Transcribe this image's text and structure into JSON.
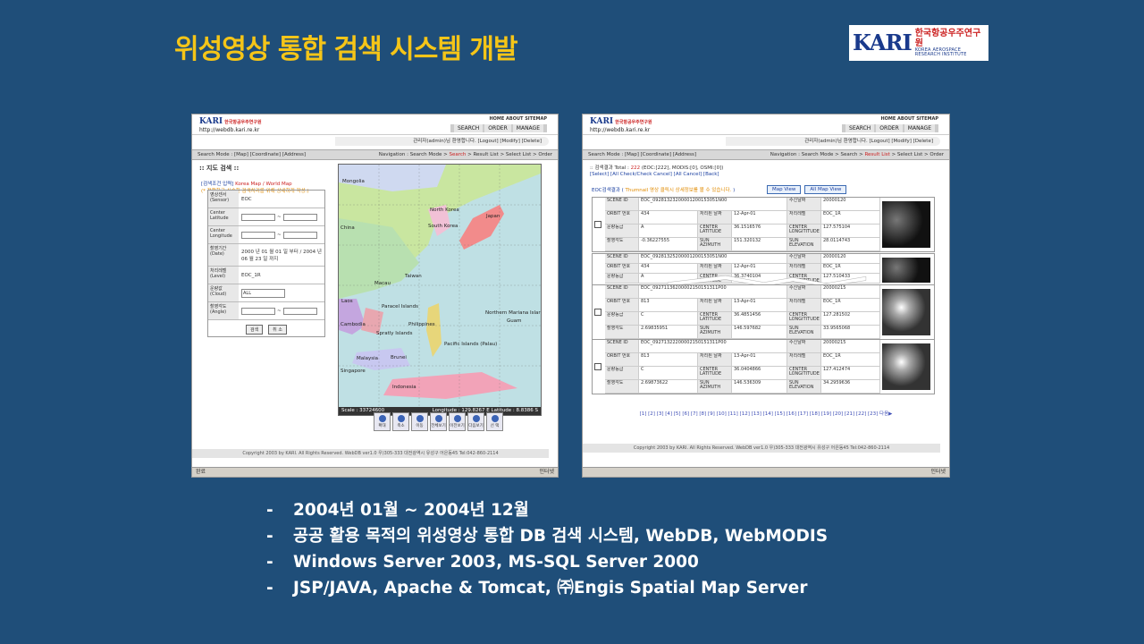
{
  "slide": {
    "title": "위성영상 통합 검색 시스템 개발",
    "logo": {
      "mark": "KARI",
      "korean": "한국항공우주연구원",
      "english": "KOREA AEROSPACE RESEARCH INSTITUTE"
    },
    "bullets": [
      "2004년 01월 ~ 2004년 12월",
      "공공 활용 목적의 위성영상 통합 DB 검색 시스템, WebDB, WebMODIS",
      "Windows Server 2003, MS-SQL Server 2000",
      "JSP/JAVA, Apache & Tomcat, ㈜Engis Spatial Map Server"
    ]
  },
  "site": {
    "logo": "KARI",
    "logo_sub": "한국항공우주연구원",
    "url": "http://webdb.kari.re.kr",
    "top_nav": "HOME  ABOUT  SITEMAP",
    "menu": [
      "SEARCH",
      "ORDER",
      "MANAGE"
    ],
    "login_bar": "관리자(admin)님 환영합니다.  [Logout]  [Modify]  [Delete]",
    "copyright": "Copyright 2003 by KARI. All Rights Reserved. WebDB ver1.0   우)305-333 대전광역시 유성구 어은동45 Tel:042-860-2114"
  },
  "left_shot": {
    "search_mode": "Search Mode : [Map]  [Coordinate]  [Address]",
    "navigation_prefix": "Navigation : Search Mode > ",
    "navigation_current": "Search",
    "navigation_suffix": " > Result List > Select List > Order",
    "form_title": ":: 지도 검색 ::",
    "form_hint_label": "[검색조건 입력]",
    "form_hint_korea": "Korea Map",
    "form_hint_sep": " / ",
    "form_hint_world": "World Map",
    "form_hint_note": "(* 정확하고 신속한 검색처리를 위해 상세하게 작성.)",
    "fields": [
      {
        "label": "영상센서 (Sensor)",
        "value": "EOC"
      },
      {
        "label": "Center Latitude",
        "value": "~"
      },
      {
        "label": "Center Longitude",
        "value": "~"
      },
      {
        "label": "촬영기간 (Date)",
        "value": "2000 년 01 월 01 일 부터 / 2004 년 06 월 23 일 까지"
      },
      {
        "label": "처리레벨 (Level)",
        "value": "EOC_1R"
      },
      {
        "label": "운량값 (Cloud)",
        "value": "ALL"
      },
      {
        "label": "촬영각도 (Angle)",
        "value": "~"
      }
    ],
    "search_btn": "검색",
    "cancel_btn": "취 소",
    "map_places": [
      "Mongolia",
      "North Korea",
      "South Korea",
      "China",
      "Japan",
      "Taiwan",
      "Macau",
      "Laos",
      "Paracel Islands",
      "Philippines",
      "Cambodia",
      "Spratly Islands",
      "Northern Mariana Islar",
      "Guam",
      "Pacific Islands (Palau)",
      "Malaysia",
      "Brunei",
      "Singapore",
      "Indonesia"
    ],
    "map_scale": "Scale : 33724600",
    "map_coords": "Longitude : 129.8267 E   Latitude : 8.8386 S",
    "tools": [
      "확대",
      "축소",
      "이동",
      "전체보기",
      "이전보기",
      "다음보기",
      "선 택"
    ],
    "status": "완료",
    "zone": "인터넷"
  },
  "right_shot": {
    "search_mode": "Search Mode : [Map]  [Coordinate]  [Address]",
    "navigation_prefix": "Navigation : Search Mode > Search > ",
    "navigation_current": "Result List",
    "navigation_suffix": " > Select List > Order",
    "total_prefix": ":: 검색결과 Total : ",
    "total_value": "222",
    "total_suffix": " (EOC:[222], MODIS:[0], OSMI:[0])",
    "links": "[Select] [All Check/Check Cancel] [All Cancel] [Back]",
    "caption_prefix": "EOC검색결과 ( ",
    "caption_note": "Thumnail 영상 클릭시 상세정보를 볼 수 있습니다.",
    "caption_suffix": " )",
    "btn_map_view": "Map View",
    "btn_all_map_view": "All Map View",
    "records": [
      {
        "scene": "EOC_09281323200001200153051N00",
        "orbit": "434",
        "proc_date": "12-Apr-01",
        "recv_date": "20000120",
        "level": "EOC_1R",
        "cloud": "A",
        "lat": "36.1516576",
        "lon": "127.575104",
        "angle": "-0.36227555",
        "sun_az": "151.320132",
        "sun_el": "28.0114743"
      },
      {
        "scene": "EOC_09281325200001200153051N00",
        "orbit": "434",
        "proc_date": "12-Apr-01",
        "recv_date": "20000120",
        "level": "EOC_1R",
        "cloud": "A",
        "lat": "36.3740104",
        "lon": "127.510433",
        "angle": "",
        "sun_az": "",
        "sun_el": ""
      },
      {
        "scene": "EOC_09271136200002150151311P00",
        "orbit": "813",
        "proc_date": "13-Apr-01",
        "recv_date": "20000215",
        "level": "EOC_1R",
        "cloud": "C",
        "lat": "36.4851456",
        "lon": "127.281502",
        "angle": "2.69835951",
        "sun_az": "146.597682",
        "sun_el": "33.9565068"
      },
      {
        "scene": "EOC_09271322200002150151311P00",
        "orbit": "813",
        "proc_date": "13-Apr-01",
        "recv_date": "20000215",
        "level": "EOC_1R",
        "cloud": "C",
        "lat": "36.0404866",
        "lon": "127.412474",
        "angle": "2.69873622",
        "sun_az": "146.536309",
        "sun_el": "34.2959636"
      }
    ],
    "labels": {
      "scene": "SCENE ID",
      "orbit": "ORBIT 번호",
      "proc": "처리된 날짜",
      "recv": "수신날짜",
      "level": "처리레벨",
      "cloud": "운량등급",
      "lat": "CENTER LATITUDE",
      "lon": "CENTER LONGITITUDE",
      "angle": "촬영각도",
      "sun_az": "SUN AZIMUTH",
      "sun_el": "SUN ELEVATION"
    },
    "pages": "[1] [2] [3] [4] [5] [6] [7] [8] [9] [10] [11] [12] [13] [14] [15] [16] [17] [18] [19] [20] [21] [22] [23] 다음▶",
    "zone": "인터넷"
  },
  "colors": {
    "background": "#1f4e79",
    "title": "#f5c518",
    "bullets": "#ffffff"
  }
}
